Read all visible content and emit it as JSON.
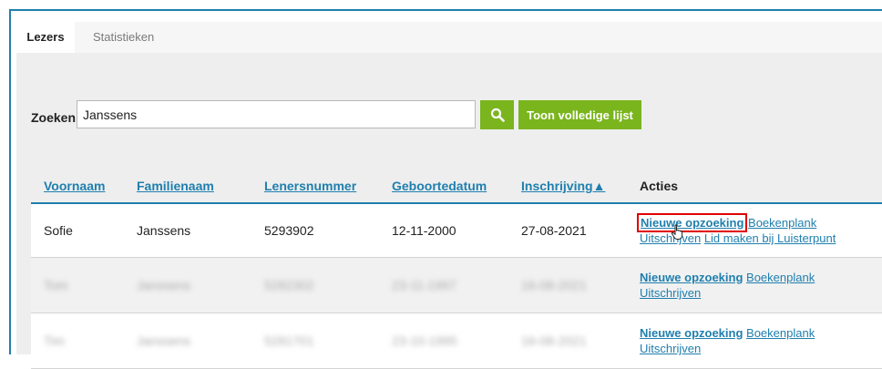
{
  "tabs": [
    "Lezers",
    "Statistieken"
  ],
  "search": {
    "label": "Zoeken",
    "value": "Janssens",
    "button_icon": "search-icon",
    "full_list_label": "Toon volledige lijst"
  },
  "table": {
    "headers": [
      "Voornaam",
      "Familienaam",
      "Lenersnummer",
      "Geboortedatum",
      "Inschrijving▲",
      "Acties"
    ],
    "rows": [
      {
        "first": "Sofie",
        "last": "Janssens",
        "number": "5293902",
        "birth": "12-11-2000",
        "reg": "27-08-2021",
        "actions": [
          "Nieuwe opzoeking",
          "Boekenplank",
          "Uitschrijven",
          "Lid maken bij Luisterpunt"
        ]
      },
      {
        "first": "Tom",
        "last": "Janssens",
        "number": "5282302",
        "birth": "23-11-1997",
        "reg": "16-08-2021",
        "actions": [
          "Nieuwe opzoeking",
          "Boekenplank",
          "Uitschrijven"
        ]
      },
      {
        "first": "Tim",
        "last": "Janssens",
        "number": "5281701",
        "birth": "23-10-1995",
        "reg": "16-08-2021",
        "actions": [
          "Nieuwe opzoeking",
          "Boekenplank",
          "Uitschrijven"
        ]
      }
    ]
  },
  "colors": {
    "accent": "#1f7fae",
    "button": "#7ab51d",
    "highlight": "#e00000"
  }
}
